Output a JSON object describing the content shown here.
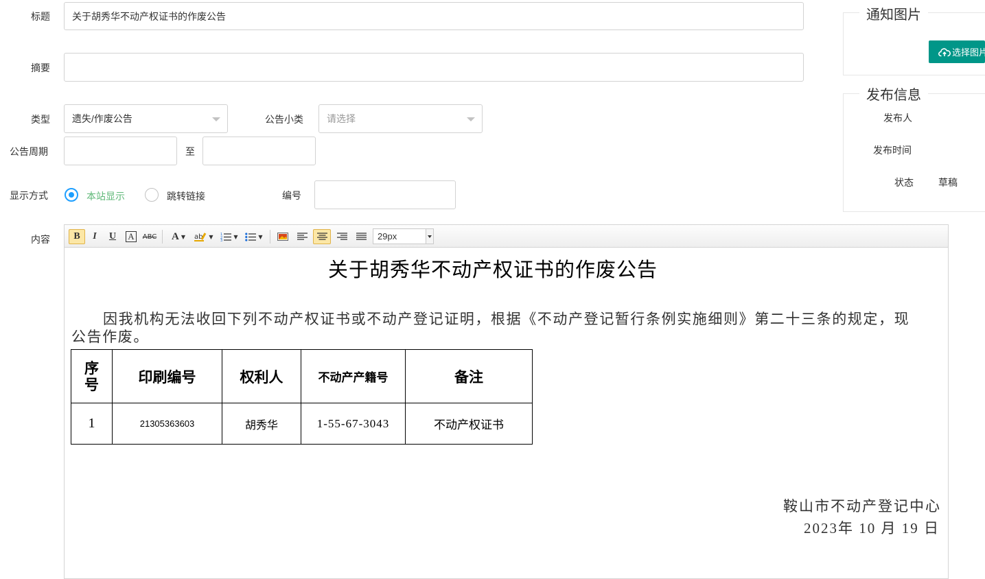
{
  "form": {
    "title_label": "标题",
    "title_value": "关于胡秀华不动产权证书的作废公告",
    "summary_label": "摘要",
    "summary_value": "",
    "type_label": "类型",
    "type_value": "遗失/作废公告",
    "subtype_label": "公告小类",
    "subtype_placeholder": "请选择",
    "period_label": "公告周期",
    "period_to": "至",
    "display_label": "显示方式",
    "display_options": [
      "本站显示",
      "跳转链接"
    ],
    "display_selected": "本站显示",
    "number_label": "编号",
    "content_label": "内容"
  },
  "side": {
    "image_legend": "通知图片",
    "select_image_button": "选择图片",
    "publish_legend": "发布信息",
    "publisher_label": "发布人",
    "publish_time_label": "发布时间",
    "status_label": "状态",
    "status_value": "草稿"
  },
  "toolbar": {
    "font_size": "29px",
    "icons": [
      "bold-icon",
      "italic-icon",
      "underline-icon",
      "font-border-icon",
      "strikethrough-icon",
      "font-color-icon",
      "highlight-icon",
      "ordered-list-icon",
      "unordered-list-icon",
      "image-icon",
      "align-left-icon",
      "align-center-icon",
      "align-right-icon",
      "align-justify-icon"
    ]
  },
  "document": {
    "title": "关于胡秀华不动产权证书的作废公告",
    "body_line1": "因我机构无法收回下列不动产权证书或不动产登记证明，根据《不动产登记暂行条例实施细则》第二十三条的规定，现",
    "body_line2": "公告作废。",
    "table": {
      "headers": [
        "序号",
        "印刷编号",
        "权利人",
        "不动产产籍号",
        "备注"
      ],
      "rows": [
        [
          "1",
          "21305363603",
          "胡秀华",
          "1-55-67-3043",
          "不动产权证书"
        ]
      ]
    },
    "signature_org": "鞍山市不动产登记中心",
    "signature_date": "2023年 10 月 19 日"
  },
  "colors": {
    "accent_green": "#009688",
    "radio_checked": "#1e9fff",
    "radio_label": "#5fb878"
  }
}
